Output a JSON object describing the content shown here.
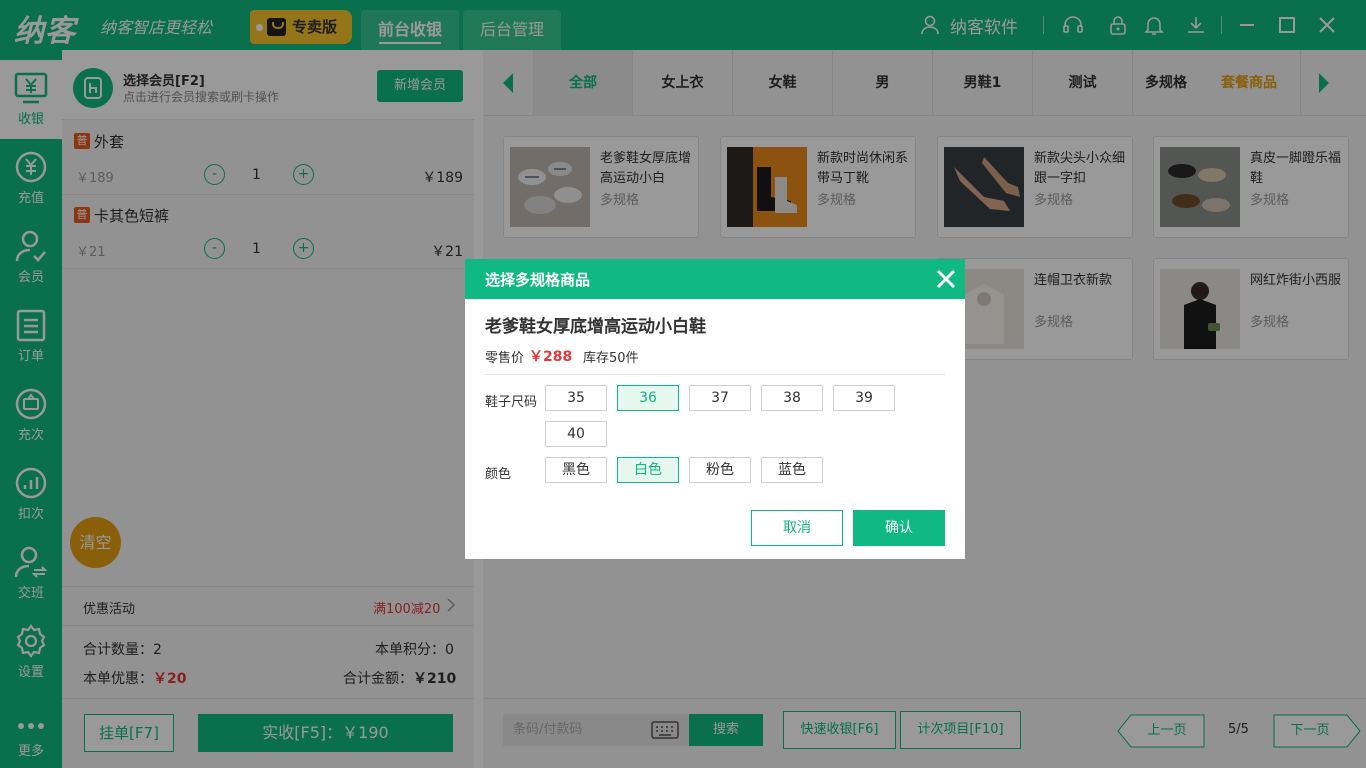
{
  "app": {
    "logo": "纳客",
    "slogan": "纳客智店更轻松",
    "edition": "专卖版",
    "company": "纳客软件",
    "tabs": [
      {
        "label": "前台收银",
        "active": true
      },
      {
        "label": "后台管理",
        "active": false
      }
    ],
    "icons": [
      "user-icon",
      "headset-icon",
      "lock-icon",
      "bell-icon",
      "download-icon",
      "minimize-icon",
      "maximize-icon",
      "close-icon"
    ],
    "accent_color": "#0fb981"
  },
  "nav": [
    {
      "label": "收银",
      "icon": "cashier-icon",
      "active": true
    },
    {
      "label": "充值",
      "icon": "recharge-icon",
      "active": false
    },
    {
      "label": "会员",
      "icon": "member-icon",
      "active": false
    },
    {
      "label": "订单",
      "icon": "order-icon",
      "active": false
    },
    {
      "label": "充次",
      "icon": "times-recharge-icon",
      "active": false
    },
    {
      "label": "扣次",
      "icon": "deduct-icon",
      "active": false
    },
    {
      "label": "交班",
      "icon": "handover-icon",
      "active": false
    },
    {
      "label": "设置",
      "icon": "settings-icon",
      "active": false
    },
    {
      "label": "更多",
      "icon": "more-icon",
      "active": false
    }
  ],
  "member": {
    "title": "选择会员[F2]",
    "hint": "点击进行会员搜索或刷卡操作",
    "add_button": "新增会员"
  },
  "cart": {
    "items": [
      {
        "tag": "普",
        "name": "外套",
        "price": "￥189",
        "qty": "1",
        "total": "￥189"
      },
      {
        "tag": "普",
        "name": "卡其色短裤",
        "price": "￥21",
        "qty": "1",
        "total": "￥21"
      }
    ],
    "minus": "-",
    "plus": "+",
    "clear_button": "清空",
    "promo_label": "优惠活动",
    "promo_value": "满100减20",
    "total_qty_label": "合计数量：",
    "total_qty": "2",
    "points_label": "本单积分：",
    "points": "0",
    "discount_label": "本单优惠：",
    "discount": "￥20",
    "total_amount_label": "合计金额：",
    "total_amount": "￥210",
    "hang_button": "挂单[F7]",
    "pay_button": "实收[F5]：￥190"
  },
  "categories": [
    "全部",
    "女上衣",
    "女鞋",
    "男",
    "男鞋1",
    "测试",
    "多规格",
    "套餐商品"
  ],
  "products": [
    {
      "name": "老爹鞋女厚底增高运动小白",
      "spec": "多规格"
    },
    {
      "name": "新款时尚休闲系带马丁靴",
      "spec": "多规格"
    },
    {
      "name": "新款尖头小众细跟一字扣",
      "spec": "多规格"
    },
    {
      "name": "真皮一脚蹬乐福鞋",
      "spec": "多规格"
    },
    {
      "name": "连帽卫衣新款",
      "spec": "多规格"
    },
    {
      "name": "网红炸街小西服",
      "spec": "多规格"
    }
  ],
  "bottom": {
    "barcode_placeholder": "条码/付款码",
    "search_button": "搜索",
    "quick_pay": "快速收银[F6]",
    "count_items": "计次项目[F10]",
    "prev_page": "上一页",
    "page": "5/5",
    "next_page": "下一页"
  },
  "dialog": {
    "title": "选择多规格商品",
    "product_name": "老爹鞋女厚底增高运动小白鞋",
    "price_label": "零售价",
    "price": "￥288",
    "stock": "库存50件",
    "size_label": "鞋子尺码",
    "sizes": [
      "35",
      "36",
      "37",
      "38",
      "39",
      "40"
    ],
    "selected_size": "36",
    "color_label": "颜色",
    "colors": [
      "黑色",
      "白色",
      "粉色",
      "蓝色"
    ],
    "selected_color": "白色",
    "cancel": "取消",
    "confirm": "确认"
  }
}
